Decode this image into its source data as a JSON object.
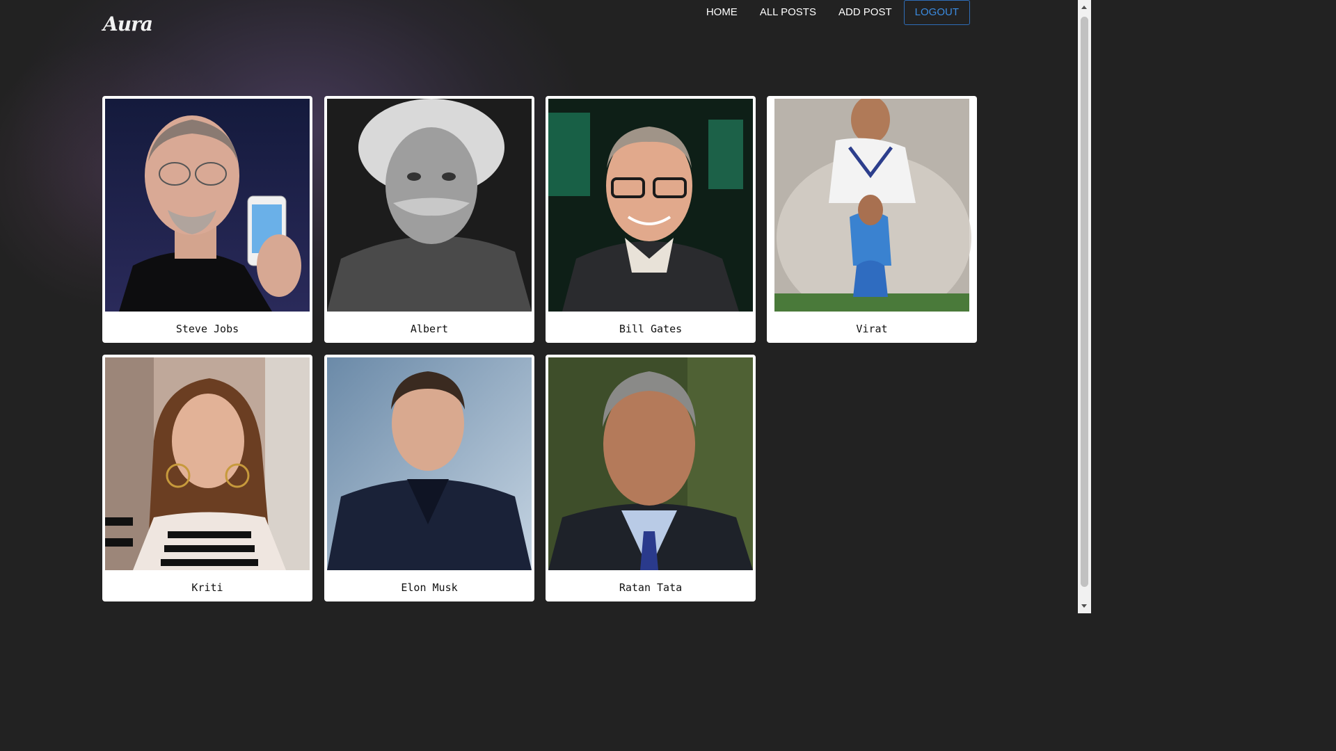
{
  "brand": {
    "logo_text": "Aura"
  },
  "nav": {
    "home": "HOME",
    "all_posts": "ALL POSTS",
    "add_post": "ADD POST",
    "logout": "LOGOUT"
  },
  "colors": {
    "background": "#222222",
    "accent": "#3b8be0",
    "card": "#ffffff"
  },
  "posts": [
    {
      "name": "Steve Jobs"
    },
    {
      "name": "Albert"
    },
    {
      "name": "Bill Gates"
    },
    {
      "name": "Virat"
    },
    {
      "name": "Kriti"
    },
    {
      "name": "Elon Musk"
    },
    {
      "name": "Ratan Tata"
    }
  ]
}
